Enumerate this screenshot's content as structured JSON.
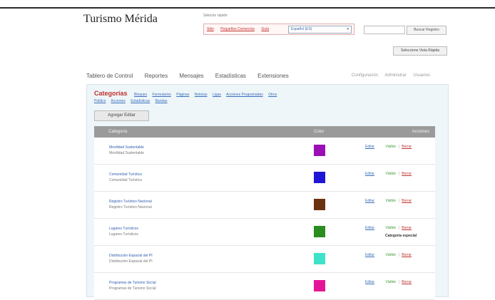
{
  "header": {
    "brand": "Turismo Mérida",
    "selector_label": "Selector rápido",
    "links": [
      "Sitio",
      "Pequeños Comercios",
      "Guía"
    ],
    "dropdown_value": "Español (ES)",
    "search_placeholder": "",
    "search_button": "Buscar Registro",
    "view_button": "Seleccione Vista Rápida"
  },
  "nav": {
    "items": [
      "Tablero de Control",
      "Reportes",
      "Mensajes",
      "Estadísticas",
      "Extensiones"
    ],
    "right": [
      "Configuración",
      "Administrar",
      "Usuarios"
    ]
  },
  "panel": {
    "title": "Categorías",
    "sublinks_row1": [
      "Bloques",
      "Formularios",
      "Páginas",
      "Noticias",
      "Ligas",
      "Acciones Programadas",
      "Otros"
    ],
    "sublinks_row2": [
      "Público",
      "Acciones",
      "Estadísticas",
      "Bandas"
    ],
    "add_button": "Agregar Editar",
    "table_headers": [
      "Categoría",
      "Color",
      "Acciones"
    ],
    "rows": [
      {
        "name": "Movilidad Sustentable",
        "desc": "Movilidad Sustentable",
        "color": "#9b0fb6",
        "edit": "Editar",
        "visible": "Visible",
        "sep": "|",
        "delete": "Borrar",
        "note": ""
      },
      {
        "name": "Comunidad Turística",
        "desc": "Comunidad Turística",
        "color": "#1f15d6",
        "edit": "Editar",
        "visible": "Visible",
        "sep": "|",
        "delete": "Borrar",
        "note": ""
      },
      {
        "name": "Registro Turístico Nacional",
        "desc": "Registro Turístico Nacional",
        "color": "#6b3211",
        "edit": "Editar",
        "visible": "Visible",
        "sep": "|",
        "delete": "Borrar",
        "note": ""
      },
      {
        "name": "Lugares Turísticos",
        "desc": "Lugares Turísticos",
        "color": "#2a8d1f",
        "edit": "Editar",
        "visible": "Visible",
        "sep": "|",
        "delete": "Borrar",
        "note": "Categoría especial"
      },
      {
        "name": "Distribución Espacial del PI",
        "desc": "Distribución Espacial del PI",
        "color": "#3de2c8",
        "edit": "Editar",
        "visible": "Visible",
        "sep": "|",
        "delete": "Borrar",
        "note": ""
      },
      {
        "name": "Programas de Turismo Social",
        "desc": "Programas de Turismo Social",
        "color": "#e51597",
        "edit": "Editar",
        "visible": "Visible",
        "sep": "|",
        "delete": "Borrar",
        "note": ""
      }
    ]
  }
}
